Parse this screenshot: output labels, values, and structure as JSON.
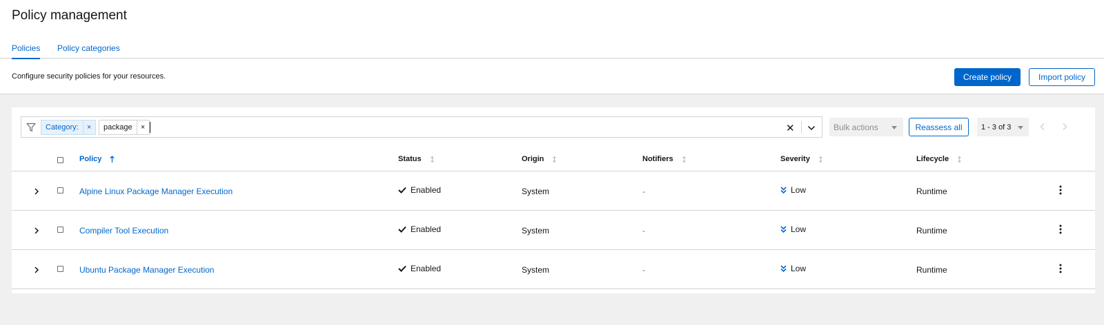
{
  "page": {
    "title": "Policy management",
    "description": "Configure security policies for your resources."
  },
  "tabs": [
    {
      "label": "Policies",
      "active": true
    },
    {
      "label": "Policy categories",
      "active": false
    }
  ],
  "actions": {
    "create": "Create policy",
    "import": "Import policy"
  },
  "filter": {
    "chips": [
      {
        "label": "Category:",
        "remove": "×"
      },
      {
        "label": "package",
        "remove": "×"
      }
    ],
    "input_value": "",
    "clear_icon": "close-icon",
    "toggle_icon": "chevron-down-icon"
  },
  "toolbar": {
    "bulk_actions": "Bulk actions",
    "reassess": "Reassess all",
    "pagination": "1 - 3 of 3"
  },
  "table": {
    "columns": [
      "Policy",
      "Status",
      "Origin",
      "Notifiers",
      "Severity",
      "Lifecycle"
    ],
    "rows": [
      {
        "policy": "Alpine Linux Package Manager Execution",
        "status": "Enabled",
        "origin": "System",
        "notifiers": "-",
        "severity": "Low",
        "lifecycle": "Runtime"
      },
      {
        "policy": "Compiler Tool Execution",
        "status": "Enabled",
        "origin": "System",
        "notifiers": "-",
        "severity": "Low",
        "lifecycle": "Runtime"
      },
      {
        "policy": "Ubuntu Package Manager Execution",
        "status": "Enabled",
        "origin": "System",
        "notifiers": "-",
        "severity": "Low",
        "lifecycle": "Runtime"
      }
    ]
  },
  "colors": {
    "primary": "#0066cc",
    "background": "#f0f0f0",
    "border": "#d2d2d2",
    "text": "#151515"
  }
}
